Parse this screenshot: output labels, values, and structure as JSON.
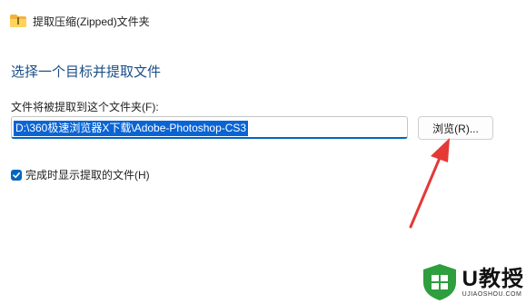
{
  "window": {
    "title": "提取压缩(Zipped)文件夹",
    "folder_icon": "folder-icon"
  },
  "main": {
    "heading": "选择一个目标并提取文件",
    "folder_label": "文件将被提取到这个文件夹(F):",
    "path_value": "D:\\360极速浏览器X下载\\Adobe-Photoshop-CS3",
    "browse_label": "浏览(R)...",
    "checkbox_label": "完成时显示提取的文件(H)",
    "checkbox_checked": true
  },
  "annotation": {
    "arrow_color": "#e53935"
  },
  "watermark": {
    "main": "U教授",
    "sub": "UJIAOSHOU.COM",
    "color": "#2e9e3e"
  },
  "colors": {
    "accent": "#0067c0",
    "heading": "#1a4f86",
    "selection": "#0a64d4"
  }
}
